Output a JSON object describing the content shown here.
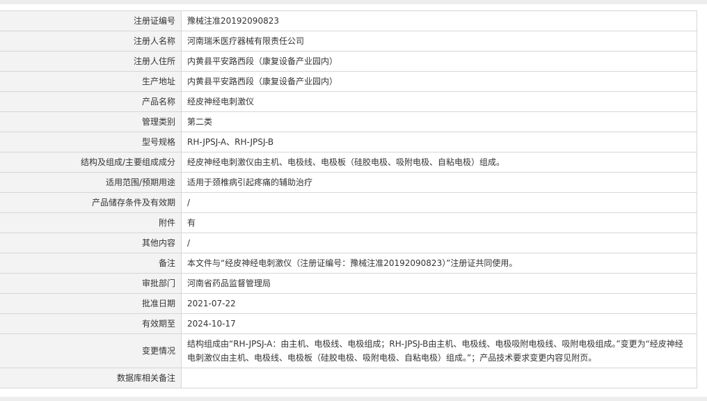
{
  "record": {
    "rows": [
      {
        "label": "注册证编号",
        "value": "豫械注准20192090823"
      },
      {
        "label": "注册人名称",
        "value": "河南瑞禾医疗器械有限责任公司"
      },
      {
        "label": "注册人住所",
        "value": "内黄县平安路西段（康复设备产业园内）"
      },
      {
        "label": "生产地址",
        "value": "内黄县平安路西段（康复设备产业园内）"
      },
      {
        "label": "产品名称",
        "value": "经皮神经电刺激仪"
      },
      {
        "label": "管理类别",
        "value": "第二类"
      },
      {
        "label": "型号规格",
        "value": "RH-JPSJ-A、RH-JPSJ-B"
      },
      {
        "label": "结构及组成/主要组成成分",
        "value": "经皮神经电刺激仪由主机、电极线、电极板（硅胶电极、吸附电极、自粘电极）组成。"
      },
      {
        "label": "适用范围/预期用途",
        "value": "适用于颈椎病引起疼痛的辅助治疗"
      },
      {
        "label": "产品储存条件及有效期",
        "value": "/"
      },
      {
        "label": "附件",
        "value": "有"
      },
      {
        "label": "其他内容",
        "value": "/"
      },
      {
        "label": "备注",
        "value": "本文件与“经皮神经电刺激仪（注册证编号：豫械注准20192090823）”注册证共同使用。"
      },
      {
        "label": "审批部门",
        "value": "河南省药品监督管理局"
      },
      {
        "label": "批准日期",
        "value": "2021-07-22"
      },
      {
        "label": "有效期至",
        "value": "2024-10-17"
      },
      {
        "label": "变更情况",
        "value": "结构组成由“RH-JPSJ-A：由主机、电极线、电极组成；RH-JPSJ-B由主机、电极线、电极吸附电极线、吸附电极组成。”变更为“经皮神经电刺激仪由主机、电极线、电极板（硅胶电极、吸附电极、自粘电极）组成。”；产品技术要求变更内容见附页。"
      },
      {
        "label": "数据库相关备注",
        "value": ""
      }
    ]
  }
}
